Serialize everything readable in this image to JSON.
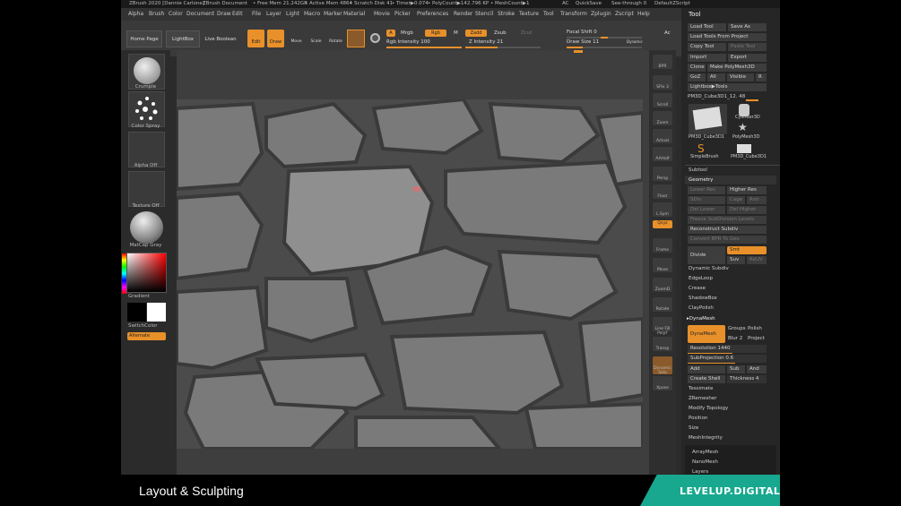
{
  "titlebar": {
    "app": "ZBrush 2020 [Dannie Carlone]",
    "doc": "ZBrush Document",
    "free_mem": "• Free Mem 21.242GB",
    "active_mem": "• Active Mem 4864",
    "scratch": "• Scratch Disk 41",
    "timer": "• Timer▶0.074",
    "polycount": "• PolyCount▶142.796 KP",
    "meshcount": "• MeshCount▶1",
    "ac": "AC",
    "quicksave": "QuickSave",
    "seethrough": "See-through 0",
    "default_script": "DefaultZScript"
  },
  "menu": [
    "Alpha",
    "Brush",
    "Color",
    "Document",
    "Draw",
    "Edit",
    "File",
    "Layer",
    "Light",
    "Macro",
    "Marker",
    "Material",
    "Movie",
    "Picker",
    "Preferences",
    "Render",
    "Stencil",
    "Stroke",
    "Texture",
    "Tool",
    "Transform",
    "Zplugin",
    "Zscript",
    "Help"
  ],
  "shelf": {
    "home_page": "Home Page",
    "lightbox": "LightBox",
    "live_boolean": "Live Boolean",
    "edit": "Edit",
    "draw": "Draw",
    "move": "Move",
    "scale": "Scale",
    "rotate": "Rotate",
    "a": "A",
    "mrgb": "Mrgb",
    "rgb": "Rgb",
    "m": "M",
    "rgb_intensity": "Rgb Intensity 100",
    "zadd": "Zadd",
    "zsub": "Zsub",
    "zcut": "Zcut",
    "z_intensity": "Z Intensity 21",
    "focal_shift": "Focal Shift 0",
    "draw_size": "Draw Size 11",
    "dynamic": "Dynamic",
    "ac": "Ac"
  },
  "left_panel": {
    "brush": "Crumple",
    "stroke": "Color Spray",
    "alpha": "Alpha Off",
    "texture": "Texture Off",
    "material": "MatCap Gray",
    "gradient": "Gradient",
    "switch_color": "SwitchColor",
    "alternate": "Alternate"
  },
  "right_strip": [
    "BPR",
    "SPix 3",
    "Scroll",
    "Zoom",
    "Actual",
    "AAHalf",
    "Persp",
    "Floor",
    "L.Sym",
    "Qxyz",
    "Frame",
    "Move",
    "ZoomD",
    "Rotate",
    "Line Fill PolyF",
    "Transp",
    "Dynamic Solo",
    "Xpose"
  ],
  "tool_panel": {
    "title": "Tool",
    "load_tool": "Load Tool",
    "save_as": "Save As",
    "load_from_project": "Load Tools From Project",
    "copy_tool": "Copy Tool",
    "paste_tool": "Paste Tool",
    "import": "Import",
    "export": "Export",
    "clone": "Clone",
    "make_polymesh": "Make PolyMesh3D",
    "goz": "GoZ",
    "all": "All",
    "visible": "Visible",
    "r": "R",
    "lightbox_tools": "Lightbox▶Tools",
    "current_tool": "PM3D_Cube3D1_12. 48",
    "thumbs": [
      "PM3D_Cube3D1",
      "PolyMesh3D",
      "SimpleBrush",
      "PM3D_Cube3D1"
    ],
    "cylinder": "Cylinder3D",
    "subtool": "Subtool",
    "geometry": "Geometry",
    "lower_res": "Lower Res",
    "higher_res": "Higher Res",
    "sdiv": "SDiv",
    "cage": "Cage",
    "rstr": "Rstr",
    "del_lower": "Del Lower",
    "del_higher": "Del Higher",
    "freeze_subdiv": "Freeze SubDivision Levels",
    "reconstruct_subdiv": "Reconstruct Subdiv",
    "convert_bpr": "Convert BPR To Geo",
    "divide": "Divide",
    "smt": "Smt",
    "suv": "Suv",
    "rel_uv": "ReUV",
    "dynamic_subdiv": "Dynamic Subdiv",
    "edgeloop": "EdgeLoop",
    "crease": "Crease",
    "shadowbox": "ShadowBox",
    "claypolish": "ClayPolish",
    "dynamesh_section": "▸DynaMesh",
    "dynamesh": "DynaMesh",
    "groups": "Groups",
    "polish": "Polish",
    "blur": "Blur 2",
    "project": "Project",
    "resolution": "Resolution 1440",
    "subprojection": "SubProjection 0.6",
    "add": "Add",
    "sub": "Sub",
    "and": "And",
    "create_shell": "Create Shell",
    "thickness": "Thickness 4",
    "sections": [
      "Tessimate",
      "ZRemesher",
      "Modify Topology",
      "Position",
      "Size",
      "MeshIntegrity"
    ],
    "bottom": [
      "ArrayMesh",
      "NanoMesh",
      "Layers"
    ]
  },
  "footer": {
    "caption": "Layout & Sculpting",
    "brand": "LEVELUP.DIGITAL"
  },
  "colors": {
    "accent": "#e8902a",
    "brand": "#17a88f"
  }
}
